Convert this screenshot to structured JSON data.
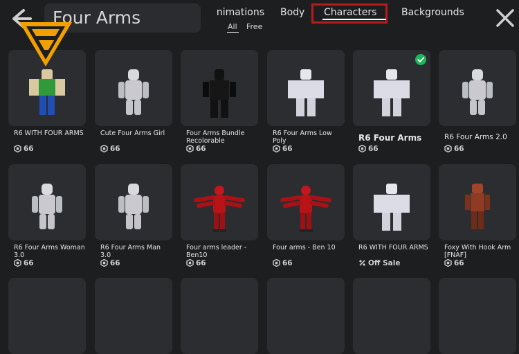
{
  "search": {
    "value": "Four Arms"
  },
  "tabs": [
    "nimations",
    "Body",
    "Characters",
    "Backgrounds"
  ],
  "subfilters": [
    "All",
    "Free"
  ],
  "colors": {
    "background": "#1d1e20",
    "card": "#2c2d30",
    "highlight": "#b71c1c",
    "logo": "#f2a000",
    "check": "#1fb55a"
  },
  "items": [
    {
      "name": "R6 WITH FOUR ARMS",
      "price": "66",
      "style": "small",
      "figure": "green"
    },
    {
      "name": "Cute Four Arms Girl",
      "price": "66",
      "style": "small",
      "figure": "grey"
    },
    {
      "name": "Four Arms Bundle Recolorable",
      "price": "66",
      "style": "small",
      "figure": "black"
    },
    {
      "name": "R6 Four Arms Low Poly",
      "price": "66",
      "style": "small",
      "figure": "blocky"
    },
    {
      "name": "R6 Four Arms",
      "price": "66",
      "style": "big",
      "figure": "blocky",
      "owned": true
    },
    {
      "name": "R6 Four Arms 2.0",
      "price": "66",
      "style": "mid",
      "figure": "grey"
    },
    {
      "name": "R6 Four Arms Woman 3.0",
      "price": "66",
      "style": "small",
      "figure": "grey"
    },
    {
      "name": "R6 Four Arms Man 3.0",
      "price": "66",
      "style": "small",
      "figure": "grey"
    },
    {
      "name": "Four arms leader - Ben10",
      "price": "66",
      "style": "small",
      "figure": "red"
    },
    {
      "name": "Four arms - Ben 10",
      "price": "66",
      "style": "small",
      "figure": "red"
    },
    {
      "name": "R6 WITH FOUR ARMS",
      "price": "Off Sale",
      "style": "small",
      "figure": "blocky",
      "offsale": true
    },
    {
      "name": "Foxy With Hook Arm [FNAF]",
      "price": "66",
      "style": "small",
      "figure": "foxy"
    }
  ]
}
